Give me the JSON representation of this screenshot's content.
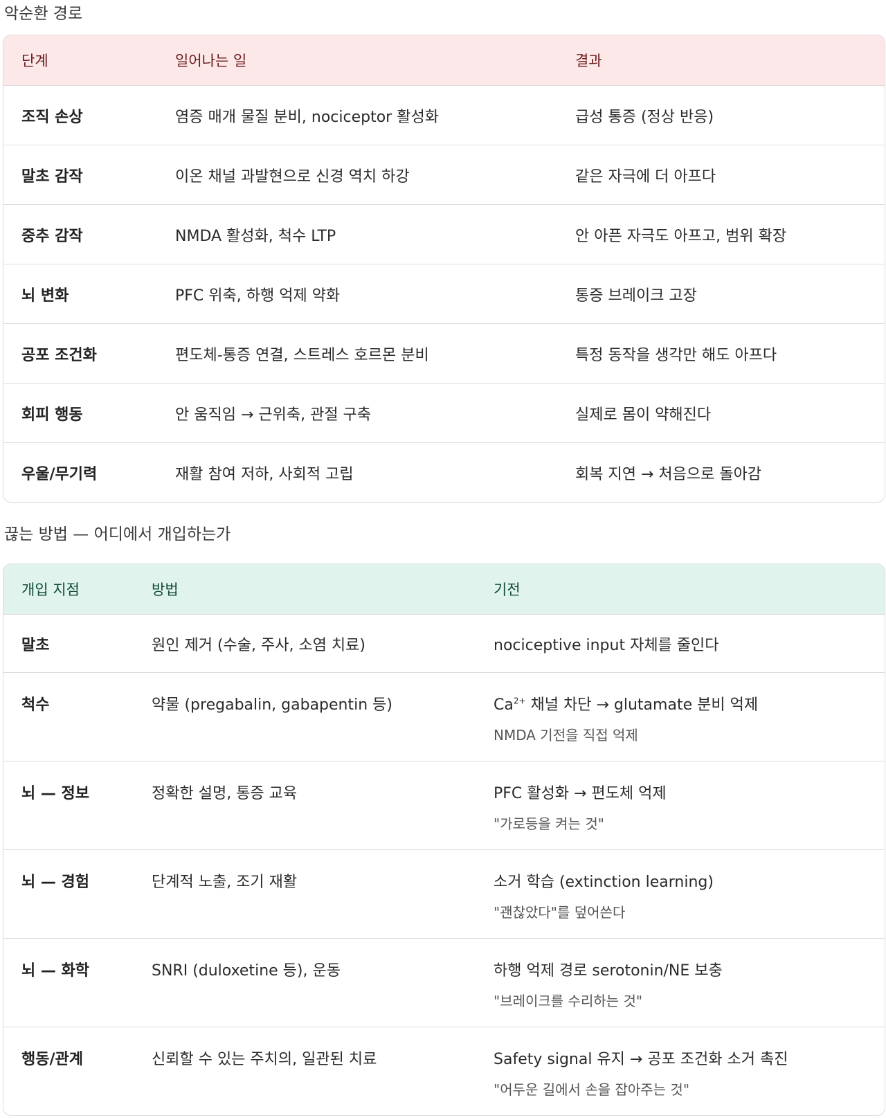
{
  "section1": {
    "title": "악순환 경로",
    "headers": [
      "단계",
      "일어나는 일",
      "결과"
    ],
    "rows": [
      {
        "stage": "조직 손상",
        "what": "염증 매개 물질 분비, nociceptor 활성화",
        "result": "급성 통증 (정상 반응)"
      },
      {
        "stage": "말초 감작",
        "what": "이온 채널 과발현으로 신경 역치 하강",
        "result": "같은 자극에 더 아프다"
      },
      {
        "stage": "중추 감작",
        "what": "NMDA 활성화, 척수 LTP",
        "result": "안 아픈 자극도 아프고, 범위 확장"
      },
      {
        "stage": "뇌 변화",
        "what": "PFC 위축, 하행 억제 약화",
        "result": "통증 브레이크 고장"
      },
      {
        "stage": "공포 조건화",
        "what": "편도체-통증 연결, 스트레스 호르몬 분비",
        "result": "특정 동작을 생각만 해도 아프다"
      },
      {
        "stage": "회피 행동",
        "what": "안 움직임 → 근위축, 관절 구축",
        "result": "실제로 몸이 약해진다"
      },
      {
        "stage": "우울/무기력",
        "what": "재활 참여 저하, 사회적 고립",
        "result": "회복 지연 → 처음으로 돌아감"
      }
    ]
  },
  "section2": {
    "title": "끊는 방법 — 어디에서 개입하는가",
    "headers": [
      "개입 지점",
      "방법",
      "기전"
    ],
    "rows": [
      {
        "point": "말초",
        "method": "원인 제거 (수술, 주사, 소염 치료)",
        "mechanism": "nociceptive input 자체를 줄인다",
        "note": ""
      },
      {
        "point": "척수",
        "method": "약물 (pregabalin, gabapentin 등)",
        "mechanism_pre": "Ca",
        "mechanism_sup": "2+",
        "mechanism_post": " 채널 차단 → glutamate 분비 억제",
        "note": "NMDA 기전을 직접 억제"
      },
      {
        "point": "뇌 — 정보",
        "method": "정확한 설명, 통증 교육",
        "mechanism": "PFC 활성화 → 편도체 억제",
        "note": "\"가로등을 켜는 것\""
      },
      {
        "point": "뇌 — 경험",
        "method": "단계적 노출, 조기 재활",
        "mechanism": "소거 학습 (extinction learning)",
        "note": "\"괜찮았다\"를 덮어쓴다"
      },
      {
        "point": "뇌 — 화학",
        "method": "SNRI (duloxetine 등), 운동",
        "mechanism": "하행 억제 경로 serotonin/NE 보충",
        "note": "\"브레이크를 수리하는 것\""
      },
      {
        "point": "행동/관계",
        "method": "신뢰할 수 있는 주치의, 일관된 치료",
        "mechanism": "Safety signal 유지 → 공포 조건화 소거 촉진",
        "note": "\"어두운 길에서 손을 잡아주는 것\""
      }
    ]
  }
}
